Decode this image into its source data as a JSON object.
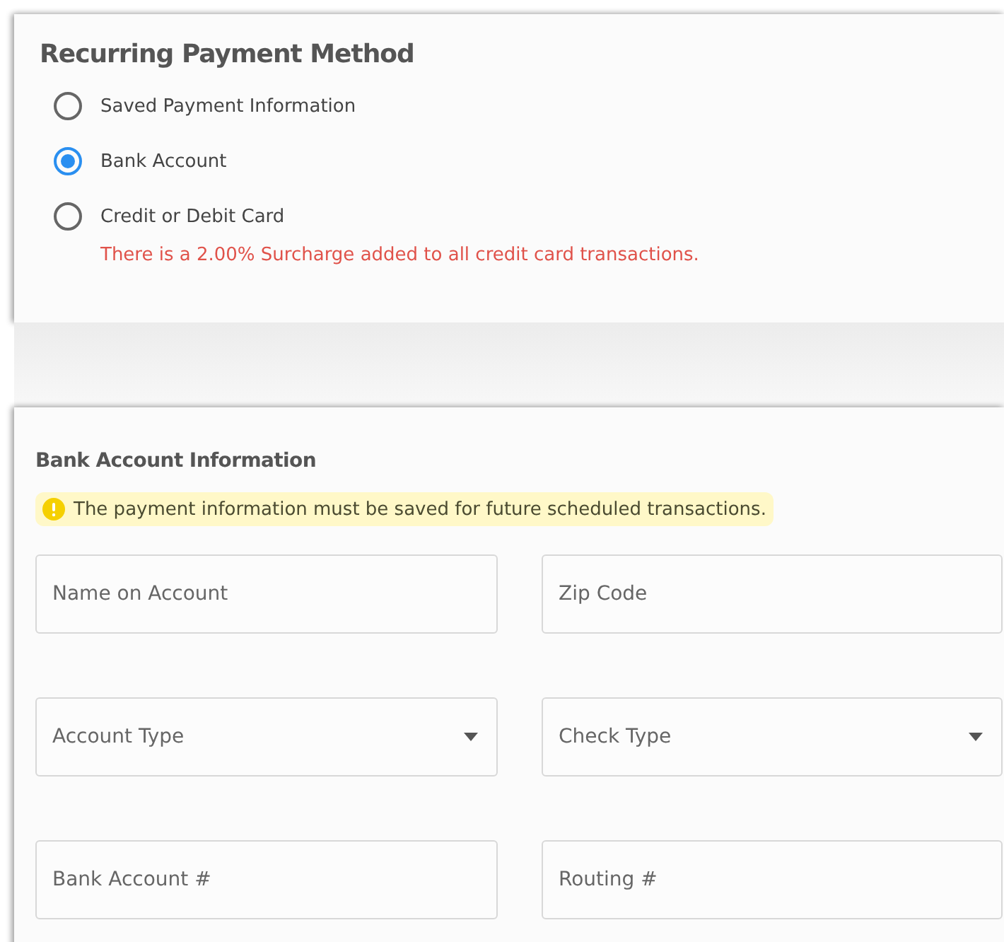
{
  "payment_method": {
    "title": "Recurring Payment Method",
    "options": [
      {
        "label": "Saved Payment Information",
        "selected": false
      },
      {
        "label": "Bank Account",
        "selected": true
      },
      {
        "label": "Credit or Debit Card",
        "selected": false
      }
    ],
    "surcharge_note": "There is a 2.00% Surcharge added to all credit card transactions."
  },
  "bank_account": {
    "title": "Bank Account Information",
    "notice": "The payment information must be saved for future scheduled transactions.",
    "fields": [
      {
        "kind": "text",
        "placeholder": "Name on Account"
      },
      {
        "kind": "text",
        "placeholder": "Zip Code"
      },
      {
        "kind": "select",
        "placeholder": "Account Type"
      },
      {
        "kind": "select",
        "placeholder": "Check Type"
      },
      {
        "kind": "text",
        "placeholder": "Bank Account #"
      },
      {
        "kind": "text",
        "placeholder": "Routing #"
      }
    ]
  }
}
